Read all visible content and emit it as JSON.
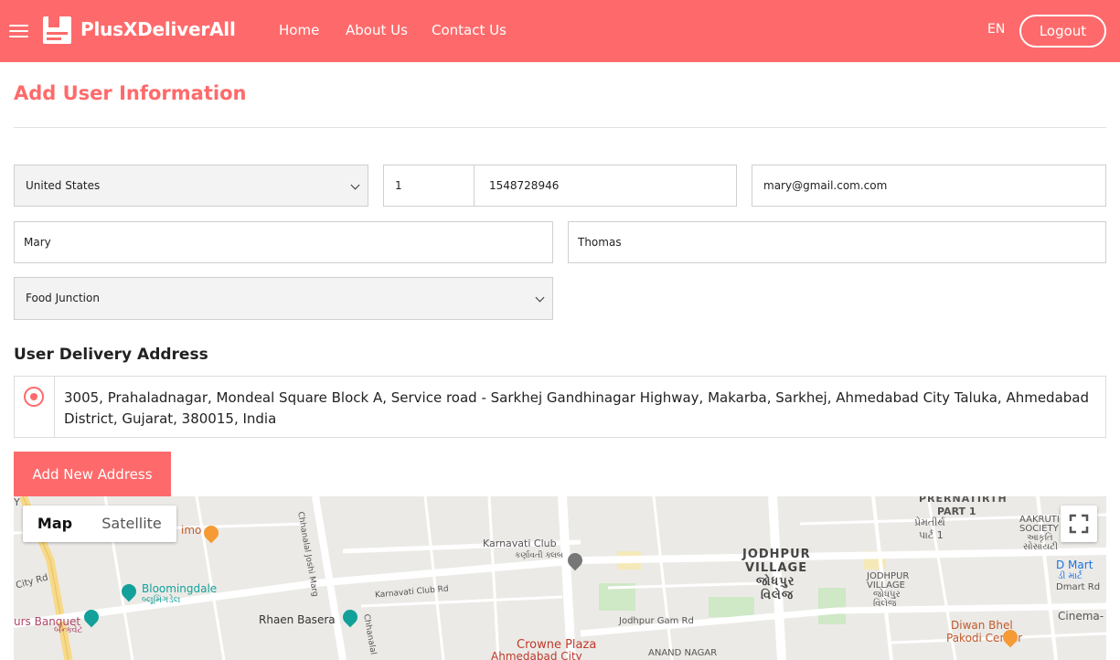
{
  "header": {
    "brand": "PlusXDeliverAll",
    "nav": [
      {
        "label": "Home"
      },
      {
        "label": "About Us"
      },
      {
        "label": "Contact Us"
      }
    ],
    "language": "EN",
    "logout_label": "Logout"
  },
  "page": {
    "title": "Add User Information"
  },
  "form": {
    "country": "United States",
    "phone_code": "1",
    "phone": "1548728946",
    "email": "mary@gmail.com.com",
    "first_name": "Mary",
    "last_name": "Thomas",
    "store": "Food Junction"
  },
  "delivery": {
    "section_title": "User Delivery Address",
    "address": "3005, Prahaladnagar, Mondeal Square Block A, Service road - Sarkhej Gandhinagar Highway, Makarba, Sarkhej, Ahmedabad City Taluka, Ahmedabad District, Gujarat, 380015, India",
    "add_button_label": "Add New Address"
  },
  "map": {
    "toggle": {
      "map": "Map",
      "satellite": "Satellite"
    },
    "places": {
      "prernatirth": "PRERNATIRTH",
      "part1": "PART 1",
      "prernatirth_gu": "પ્રેમતીર્થ",
      "part1_gu": "પાર્ટ 1",
      "aakruti": "AAKRUTI",
      "society": "SOCIETY",
      "aakruti_gu": "આકૃતિ",
      "society_gu": "સોસાયટી",
      "dmart": "D Mart",
      "dmart_gu": "ડી માર્ટ",
      "dmart_rd": "Dmart Rd",
      "jodhpur_village": "JODHPUR",
      "jodhpur_village2": "VILLAGE",
      "jodhpur_gu": "જોધપુર",
      "vilej_gu": "વિલેજ",
      "jodhpur_small": "JODHPUR",
      "village_small": "VILLAGE",
      "jodhpur_small_gu": "જોધપુર",
      "village_small_gu": "વિલેજ",
      "karnavati_club": "Karnavati Club",
      "karnavati_club_gu": "કર્ણાવતી ક્લબ",
      "karnavati_club_rd": "Karnavati Club Rd",
      "bloomingdale": "Bloomingdale",
      "bloomingdale_gu": "બ્લૂમિંગડેલ",
      "rhaen_basera": "Rhaen Basera",
      "city_rd": "City Rd",
      "urs_banquet": "urs Banquet",
      "urs_banquet_gu": "બેન્ક્વેટ",
      "crowne_plaza": "Crowne Plaza",
      "crowne_plaza2": "Ahmedabad City",
      "jodhpur_gam_rd": "Jodhpur Gam Rd",
      "anand_nagar": "ANAND NAGAR",
      "diwan_bhel": "Diwan Bhel",
      "pakodi_center": "Pakodi Center",
      "cinema": "Cinema- S",
      "imo": "imo",
      "joshi_marg": "Chhanalal Joshi Marg",
      "chhanalal": "Chhanalal",
      "y_label": "Y"
    }
  }
}
